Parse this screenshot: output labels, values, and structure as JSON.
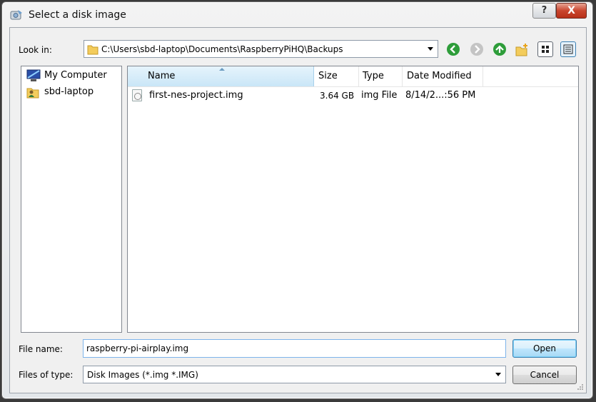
{
  "window": {
    "title": "Select a disk image",
    "help_label": "?",
    "close_label": "X"
  },
  "toolbar": {
    "look_in_label": "Look in:",
    "look_in_value": "C:\\Users\\sbd-laptop\\Documents\\RaspberryPiHQ\\Backups",
    "icons": [
      "back-icon",
      "forward-icon",
      "up-folder-icon",
      "new-folder-icon",
      "list-view-icon",
      "detail-view-icon"
    ]
  },
  "sidebar": {
    "items": [
      {
        "label": "My Computer",
        "icon": "computer-icon"
      },
      {
        "label": "sbd-laptop",
        "icon": "user-folder-icon"
      }
    ]
  },
  "file_list": {
    "columns": [
      "Name",
      "Size",
      "Type",
      "Date Modified"
    ],
    "sorted_by": "Name",
    "rows": [
      {
        "name": "first-nes-project.img",
        "size": "3.64 GB",
        "type": "img File",
        "date": "8/14/2...:56 PM"
      }
    ]
  },
  "footer": {
    "file_name_label": "File name:",
    "file_name_value": "raspberry-pi-airplay.img",
    "file_type_label": "Files of type:",
    "file_type_value": "Disk Images (*.img *.IMG)",
    "open_label": "Open",
    "cancel_label": "Cancel"
  },
  "colors": {
    "accent": "#3399ff",
    "back_green": "#2e9d3a",
    "close_red": "#c9452e"
  }
}
